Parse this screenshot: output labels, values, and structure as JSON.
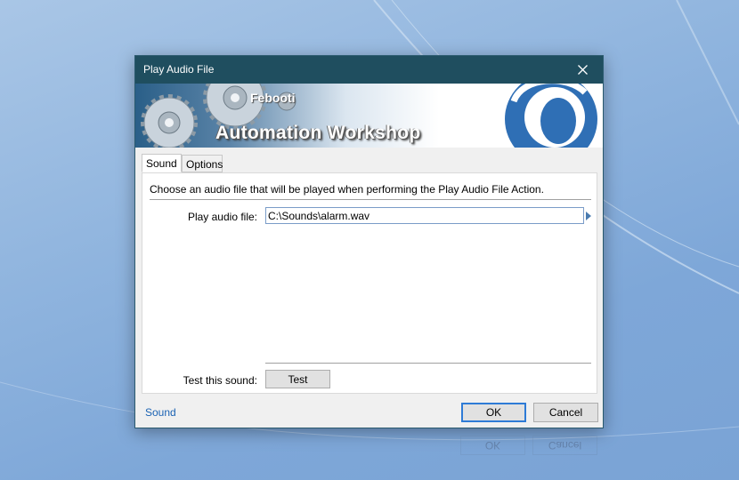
{
  "window": {
    "title": "Play Audio File",
    "close_glyph": "✕"
  },
  "banner": {
    "brand_small": "Febooti",
    "brand_big": "Automation Workshop"
  },
  "tabs": [
    {
      "label": "Sound",
      "active": true
    },
    {
      "label": "Options",
      "active": false
    }
  ],
  "panel": {
    "intro": "Choose an audio file that will be played when performing the Play Audio File Action.",
    "file_label": "Play audio file:",
    "file_value": "C:\\Sounds\\alarm.wav",
    "test_label": "Test this sound:",
    "test_button": "Test"
  },
  "footer": {
    "help_link": "Sound",
    "ok": "OK",
    "cancel": "Cancel"
  },
  "colors": {
    "titlebar": "#1f4e5f",
    "link": "#1a62b3",
    "ok_focus": "#2e7bd6"
  }
}
